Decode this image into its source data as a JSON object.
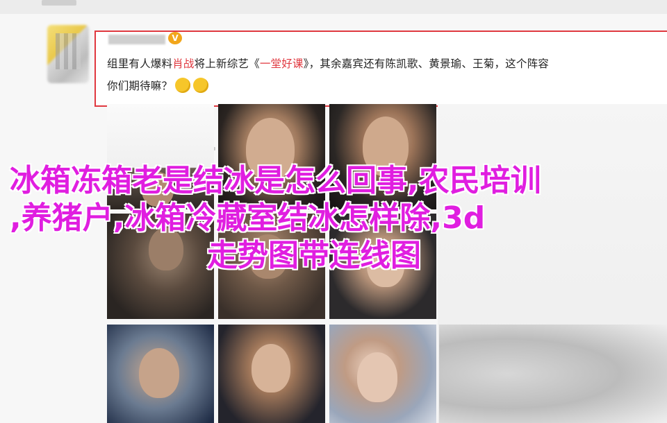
{
  "post": {
    "verified_badge": "V",
    "line1_prefix": "组里有人爆料",
    "line1_highlight1": "肖战",
    "line1_mid": "将上新综艺《",
    "line1_highlight2": "一堂好课",
    "line1_suffix": "》，其余嘉宾还有陈凯歌、黄景瑜、王菊，这个阵容",
    "line2_text": "你们期待嘛？",
    "emoji_name": "thinking-face-emoji"
  },
  "overlay": {
    "line1": "冰箱冻箱老是结冰是怎么回事,农民培训",
    "line2": ",养猪户,冰箱冷藏室结冰怎样除,3d",
    "line3": "走势图带连线图"
  },
  "colors": {
    "highlight_border": "#e0383f",
    "overlay_text": "#e01ee0",
    "badge": "#f2a61b"
  }
}
